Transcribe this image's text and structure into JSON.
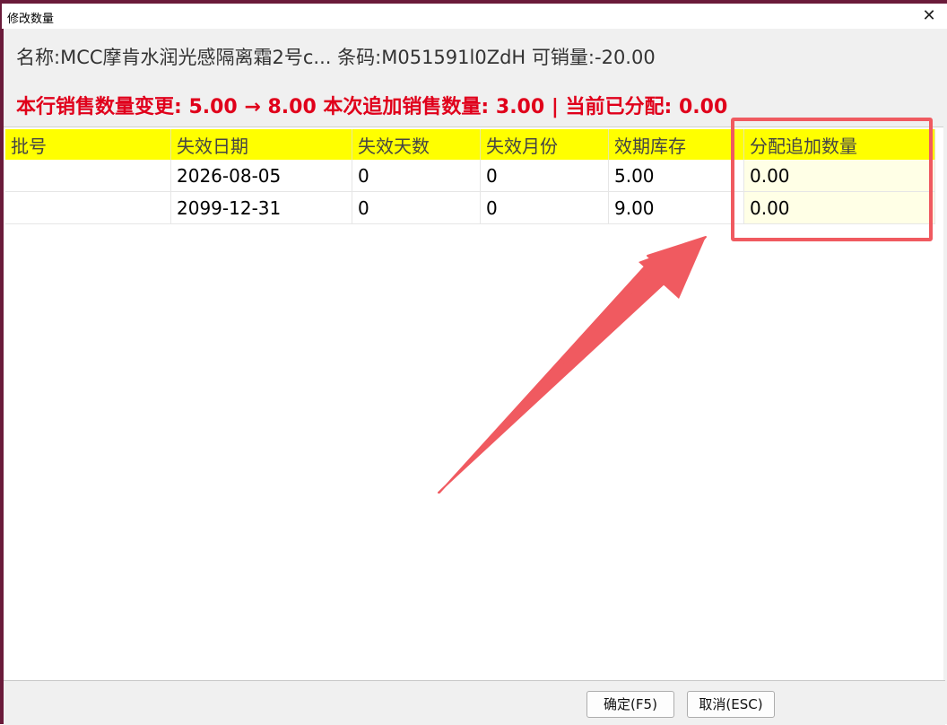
{
  "window": {
    "title": "修改数量",
    "close_glyph": "✕"
  },
  "info": {
    "name_label": "名称:",
    "name_value": "MCC摩肯水润光感隔离霜2号c...",
    "barcode_label": "条码:",
    "barcode_value": "M051591l0ZdH",
    "available_label": "可销量:",
    "available_value": "-20.00"
  },
  "change": {
    "text": "本行销售数量变更: 5.00 → 8.00  本次追加销售数量: 3.00 |  当前已分配: 0.00"
  },
  "table": {
    "columns": [
      "批号",
      "失效日期",
      "失效天数",
      "失效月份",
      "效期库存",
      "分配追加数量"
    ],
    "rows": [
      [
        "",
        "2026-08-05",
        "0",
        "0",
        "5.00",
        "0.00"
      ],
      [
        "",
        "2099-12-31",
        "0",
        "0",
        "9.00",
        "0.00"
      ]
    ]
  },
  "buttons": {
    "ok": "确定(F5)",
    "cancel": "取消(ESC)"
  },
  "colors": {
    "header_bg": "#ffff00",
    "highlight": "#e0001b",
    "annotation": "#f05a60"
  },
  "icons": {
    "close": "close-icon",
    "annotation_arrow": "arrow-annotation"
  }
}
